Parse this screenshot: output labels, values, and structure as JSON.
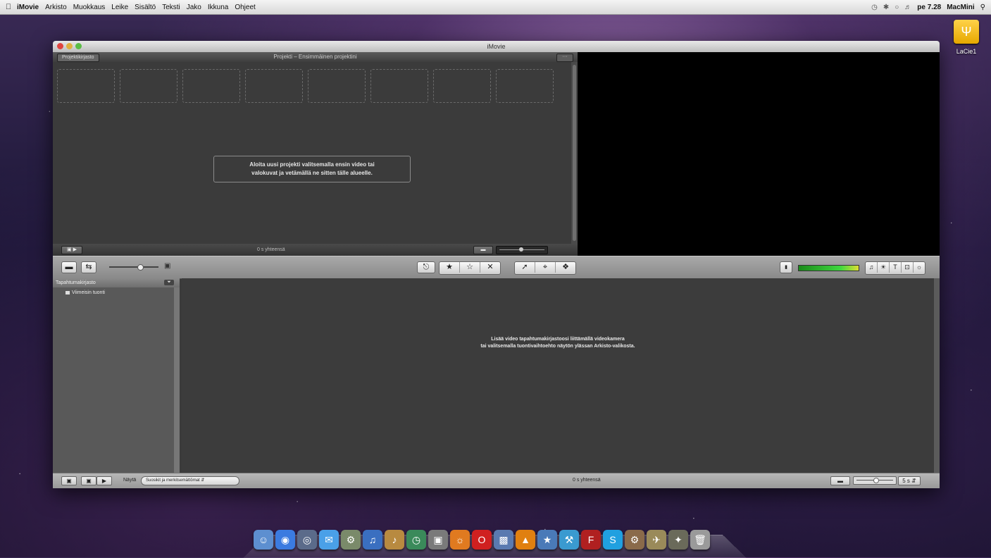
{
  "menubar": {
    "app_name": "iMovie",
    "items": [
      "Arkisto",
      "Muokkaus",
      "Leike",
      "Sisältö",
      "Teksti",
      "Jako",
      "Ikkuna",
      "Ohjeet"
    ],
    "clock": "pe 7.28",
    "computer_name": "MacMini"
  },
  "desktop": {
    "drive_label": "LaCie1"
  },
  "window": {
    "title": "iMovie",
    "project_pane": {
      "library_button": "Projektikirjasto",
      "title": "Projekti – Ensimmäinen projektini",
      "placeholder_line1": "Aloita uusi projekti valitsemalla ensin video tai",
      "placeholder_line2": "valokuvat ja vetämällä ne sitten tälle alueelle.",
      "total": "0 s yhteensä"
    },
    "event_library": {
      "header": "Tapahtumakirjasto",
      "item": "Viimeisin tuonti"
    },
    "event_browser": {
      "message_line1": "Lisää video tapahtumakirjastoosi liittämällä videokamera",
      "message_line2": "tai valitsemalla tuontivaihtoehto näytön ylässan Arkisto-valikosta.",
      "total": "0 s yhteensä"
    },
    "bottom_bar": {
      "show_label": "Näytä",
      "show_select": "Suosikit ja merkitsemättömat",
      "duration": "5 s"
    }
  },
  "colors": {
    "viewer": "#000000",
    "pane": "#3b3b3b",
    "toolbar": "#9a9a9a",
    "audio_meter": "#3fd83f"
  },
  "dock": {
    "icons": [
      "finder-icon",
      "safari-icon",
      "dashboard-icon",
      "ichat-icon",
      "iphoto-icon",
      "itunes-icon",
      "garageband-icon",
      "timemachine-icon",
      "preview-icon",
      "firefox-icon",
      "opera-icon",
      "photo-icon",
      "vlc-icon",
      "imovie-icon",
      "xcode-icon",
      "filezilla-icon",
      "skype-icon",
      "system-icon",
      "app-icon",
      "star-icon",
      "trash-icon"
    ]
  }
}
